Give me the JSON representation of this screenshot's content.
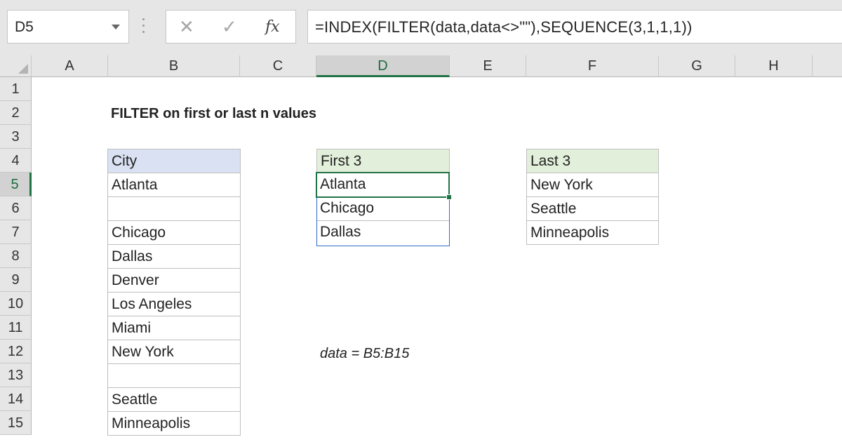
{
  "formula_bar": {
    "name_box": "D5",
    "cancel_icon": "✕",
    "enter_icon": "✓",
    "fx_icon": "fx",
    "formula": "=INDEX(FILTER(data,data<>\"\"),SEQUENCE(3,1,1,1))"
  },
  "columns": [
    "A",
    "B",
    "C",
    "D",
    "E",
    "F",
    "G",
    "H"
  ],
  "rows": [
    "1",
    "2",
    "3",
    "4",
    "5",
    "6",
    "7",
    "8",
    "9",
    "10",
    "11",
    "12",
    "13",
    "14",
    "15"
  ],
  "sheet": {
    "title": "FILTER on first or last n values",
    "city_table": {
      "header": "City",
      "values": [
        "Atlanta",
        "",
        "Chicago",
        "Dallas",
        "Denver",
        "Los Angeles",
        "Miami",
        "New York",
        "",
        "Seattle",
        "Minneapolis"
      ]
    },
    "first_table": {
      "header": "First 3",
      "values": [
        "Atlanta",
        "Chicago",
        "Dallas"
      ]
    },
    "last_table": {
      "header": "Last 3",
      "values": [
        "New York",
        "Seattle",
        "Minneapolis"
      ]
    },
    "note": "data = B5:B15"
  },
  "selection": {
    "column": "D",
    "row": "5"
  },
  "colors": {
    "excel_green": "#217346",
    "city_header_fill": "#d9e1f2",
    "result_header_fill": "#e2efda",
    "spill_border": "#2f6cc4"
  }
}
